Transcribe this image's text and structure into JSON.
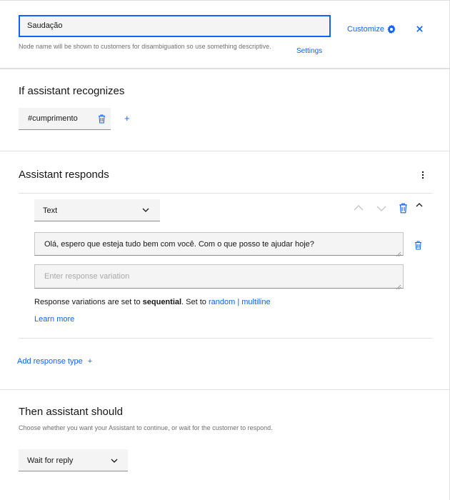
{
  "node": {
    "name_value": "Saudação",
    "helper": "Node name will be shown to customers for disambiguation so use something descriptive.",
    "settings_link": "Settings",
    "customize_label": "Customize"
  },
  "recognizes": {
    "title": "If assistant recognizes",
    "condition_tag": "#cumprimento",
    "add_symbol": "+"
  },
  "responds": {
    "title": "Assistant responds",
    "type_select": "Text",
    "variation_1": "Olá, espero que esteja tudo bem com você. Com o que posso te ajudar hoje?",
    "variation_placeholder": "Enter response variation",
    "info_prefix": "Response variations are set to ",
    "info_bold": "sequential",
    "info_middle": ". Set to ",
    "info_random": "random",
    "info_separator": " | ",
    "info_multiline": "multiline",
    "learn_more": "Learn more",
    "add_response_type": "Add response type",
    "add_symbol": "+"
  },
  "then": {
    "title": "Then assistant should",
    "description": "Choose whether you want your Assistant to continue, or wait for the customer to respond.",
    "select_value": "Wait for reply"
  },
  "icons": {
    "settings": "gear-icon",
    "close": "close-icon",
    "delete": "trash-icon",
    "overflow": "overflow-menu-icon",
    "chevron": "chevron-down-icon",
    "move_up": "chevron-up-icon",
    "move_down": "chevron-down-icon",
    "collapse": "caret-up-icon"
  },
  "colors": {
    "accent": "#0f62fe",
    "field_bg": "#f4f4f4",
    "border": "#e0e0e0",
    "text": "#161616",
    "muted": "#6f6f6f"
  }
}
